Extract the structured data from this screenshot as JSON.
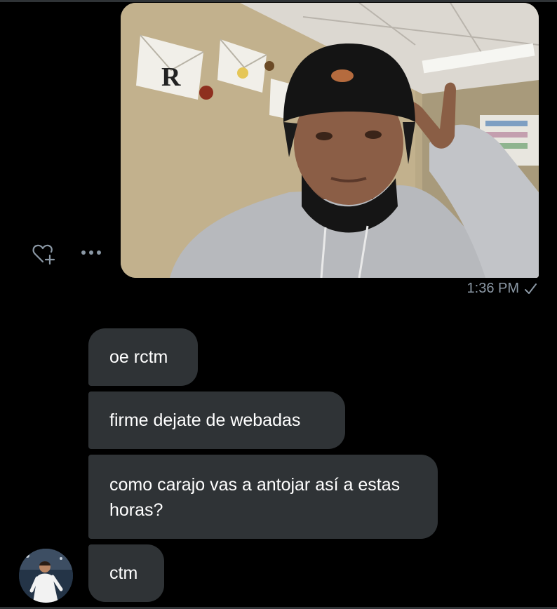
{
  "conversation": {
    "sent_photo": {
      "alt": "",
      "timestamp": "1:36 PM",
      "status_icon": "check-icon"
    },
    "actions": {
      "like_icon": "heart-plus-icon",
      "more_icon": "more-horizontal-icon"
    },
    "received_messages": [
      {
        "text": "oe rctm"
      },
      {
        "text": "firme dejate de webadas"
      },
      {
        "text": "como carajo vas a antojar así a estas horas?"
      },
      {
        "text": "ctm"
      }
    ],
    "sender_avatar_icon": "avatar"
  },
  "colors": {
    "background": "#000000",
    "bubble": "#2f3336",
    "timestamp": "#8b98a5",
    "text": "#ffffff"
  }
}
